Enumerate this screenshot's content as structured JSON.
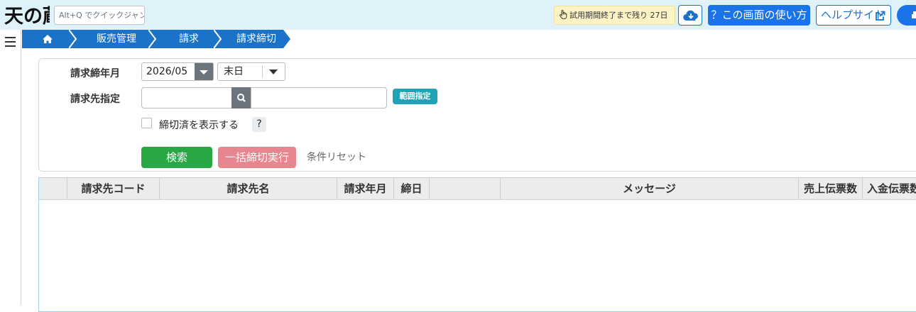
{
  "header": {
    "logo_text": "天の蔵",
    "quick_jump_placeholder": "Alt+Q でクイックジャンプ",
    "trial_notice": "試用期間終了まで残り 27日",
    "howto_button": "？この画面の使い方",
    "help_site_button": "ヘルプサイト"
  },
  "breadcrumb": {
    "items": [
      "販売管理",
      "請求",
      "請求締切"
    ]
  },
  "form": {
    "closing_month_label": "請求締年月",
    "closing_month_value": "2026/05",
    "closing_day_value": "末日",
    "customer_label": "請求先指定",
    "range_button": "範囲指定",
    "show_closed_label": "締切済を表示する",
    "show_closed_checked": false,
    "help_q": "?",
    "search_button": "検索",
    "bulk_close_button": "一括締切実行",
    "reset_link": "条件リセット"
  },
  "grid": {
    "columns": [
      "",
      "請求先コード",
      "請求先名",
      "請求年月",
      "締日",
      "",
      "メッセージ",
      "売上伝票数",
      "入金伝票数"
    ],
    "rows": []
  },
  "colors": {
    "topbar": "#dff1f9",
    "breadcrumb": "#1a73c9",
    "primary": "#1a73e8",
    "success": "#28a745",
    "danger_light": "#e8868f",
    "info": "#20a1b5"
  }
}
